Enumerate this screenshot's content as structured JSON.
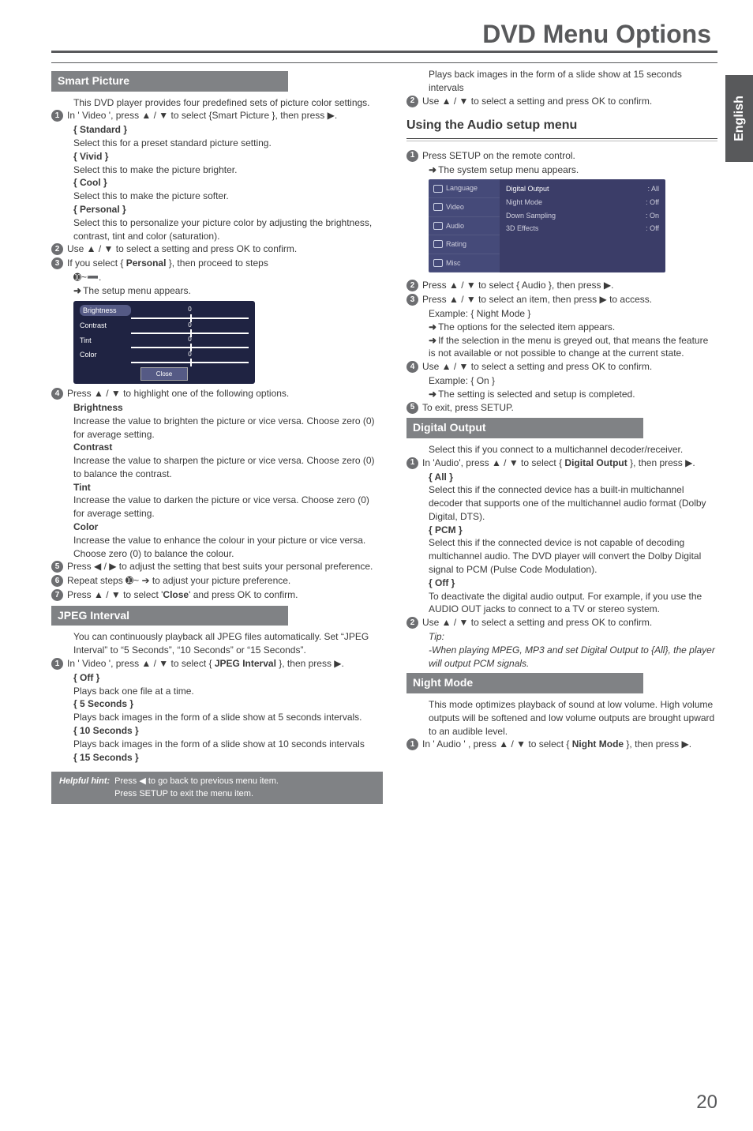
{
  "page": {
    "title": "DVD Menu Options",
    "side_tab": "English",
    "page_number": "20"
  },
  "hint": {
    "label": "Helpful hint:",
    "line1": "Press ◀ to go back to previous menu item.",
    "line2": "Press SETUP to exit the menu item."
  },
  "left": {
    "smart_picture": {
      "heading": "Smart Picture",
      "intro": "This DVD player provides four predefined sets of picture color settings.",
      "step1": "In ' Video ', press ▲ / ▼ to select {Smart Picture }, then press ▶.",
      "opt_standard_label": "{ Standard }",
      "opt_standard_desc": "Select this for a preset standard picture setting.",
      "opt_vivid_label": "{ Vivid }",
      "opt_vivid_desc": "Select this to make the picture brighter.",
      "opt_cool_label": "{ Cool }",
      "opt_cool_desc": "Select this to make the picture softer.",
      "opt_personal_label": "{ Personal }",
      "opt_personal_desc": "Select this to personalize your picture color by adjusting the brightness, contrast, tint and color (saturation).",
      "step2": "Use ▲ / ▼ to select a setting and press OK to confirm.",
      "step3a": "If you select { ",
      "step3b": "Personal",
      "step3c": " }, then proceed to steps",
      "step3d": "➓~➖.",
      "setup_appears": "The setup menu appears.",
      "slider": {
        "brightness": "Brightness",
        "contrast": "Contrast",
        "tint": "Tint",
        "color": "Color",
        "close": "Close",
        "zero": "0"
      },
      "step4": "Press ▲ / ▼ to highlight one of the following options.",
      "brightness_h": "Brightness",
      "brightness_d": "Increase the value to brighten the picture or vice versa. Choose zero (0) for average setting.",
      "contrast_h": "Contrast",
      "contrast_d": "Increase the value to sharpen the picture or vice versa.  Choose zero (0) to balance the contrast.",
      "tint_h": "Tint",
      "tint_d": "Increase the value to darken the picture or vice versa.  Choose zero (0) for average setting.",
      "color_h": "Color",
      "color_d": "Increase the value to enhance the colour in your picture or vice versa. Choose zero (0) to balance the colour.",
      "step5": "Press ◀ / ▶ to adjust the setting that best suits your personal preference.",
      "step6": "Repeat steps ➓~ ➔ to adjust your picture preference.",
      "step7a": "Press ▲ / ▼ to select  '",
      "step7b": "Close",
      "step7c": "'  and press OK to confirm."
    },
    "jpeg": {
      "heading": "JPEG Interval",
      "intro": "You can continuously playback all JPEG files automatically. Set “JPEG Interval” to “5 Seconds”, “10 Seconds” or “15 Seconds”.",
      "step1a": "In ' Video ', press ▲ / ▼ to select  { ",
      "step1b": "JPEG Interval",
      "step1c": " }, then press ▶.",
      "off_label": "{ Off }",
      "off_desc": "Plays back one file at a time.",
      "s5_label": "{ 5 Seconds }",
      "s5_desc": "Plays back images in the form of a slide show at 5 seconds intervals.",
      "s10_label": "{ 10 Seconds }",
      "s10_desc": "Plays back images in the form of a slide show at 10 seconds intervals",
      "s15_label": "{ 15 Seconds }"
    }
  },
  "right": {
    "top": {
      "s15_desc": "Plays back images in the form of a slide show at 15 seconds intervals",
      "step2": "Use ▲ / ▼ to select a setting and press OK to confirm."
    },
    "audio_setup": {
      "heading": "Using the Audio setup menu",
      "step1": "Press SETUP on the remote control.",
      "appears": "The system setup menu appears.",
      "menu_left": {
        "lang": "Language",
        "video": "Video",
        "audio": "Audio",
        "rating": "Rating",
        "misc": "Misc"
      },
      "menu_right": {
        "digital_output_k": "Digital Output",
        "digital_output_v": ": All",
        "night_mode_k": "Night  Mode",
        "night_mode_v": ": Off",
        "down_sampling_k": "Down Sampling",
        "down_sampling_v": ": On",
        "effects_k": "3D Effects",
        "effects_v": ": Off"
      },
      "step2": "Press ▲ / ▼ to select { Audio }, then press ▶.",
      "step3": "Press ▲ / ▼ to select an item, then press ▶ to access.",
      "example_label": "Example: { Night Mode }",
      "opt_appears": "The options for the selected item appears.",
      "greyed": "If the selection in the menu is greyed out, that means the feature is not available or not possible to change at the current state.",
      "step4": "Use ▲ / ▼ to select a setting and press OK to confirm.",
      "example_on": "Example: { On }",
      "completed": "The setting is selected and setup is completed.",
      "step5": "To exit, press SETUP."
    },
    "digital_output": {
      "heading": "Digital Output",
      "intro": "Select this if you connect to a multichannel decoder/receiver.",
      "step1a": "In 'Audio', press ▲ / ▼ to select { ",
      "step1b": "Digital Output",
      "step1c": " }, then press ▶.",
      "all_label": "{ All }",
      "all_desc": "Select this if the connected device has a built-in multichannel decoder that supports one of the multichannel audio format (Dolby Digital, DTS).",
      "pcm_label": "{ PCM }",
      "pcm_desc": "Select this if the connected device is not capable of decoding multichannel audio. The DVD player will convert the Dolby Digital signal to PCM (Pulse Code Modulation).",
      "off_label": "{ Off }",
      "off_desc": "To deactivate the digital audio output. For example, if you use the AUDIO OUT jacks to connect to a TV or stereo system.",
      "step2": "Use ▲ / ▼ to select a setting  and press OK to confirm.",
      "tip_label": "Tip:",
      "tip_body": "-When playing MPEG, MP3 and set Digital Output to {All}, the player will output PCM signals."
    },
    "night_mode": {
      "heading": "Night Mode",
      "intro": "This mode optimizes playback of sound at low volume. High volume outputs will be softened and low volume outputs are brought upward to an audible level.",
      "step1a": "In  ' Audio ' , press ▲ / ▼ to select { ",
      "step1b": "Night Mode",
      "step1c": " }, then press ▶."
    }
  }
}
